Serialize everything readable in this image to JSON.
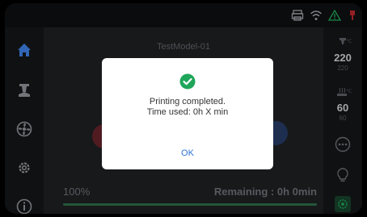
{
  "job": {
    "model_name": "TestModel-01",
    "progress_text": "100%",
    "progress_fraction": 1.0,
    "remaining_text": "Remaining : 0h 0min"
  },
  "temps": {
    "nozzle_current": "220",
    "nozzle_target": "220",
    "bed_current": "60",
    "bed_target": "60"
  },
  "dialog": {
    "message_line1": "Printing completed.",
    "message_line2": "Time used: 0h X min",
    "ok_label": "OK"
  },
  "icons": {
    "status": [
      "printer-icon",
      "wifi-icon",
      "warning-icon",
      "usb-icon"
    ],
    "sidebar": [
      "home-icon",
      "nozzle-icon",
      "fan-icon",
      "settings-icon",
      "info-icon"
    ],
    "right": [
      "nozzle-temp-icon",
      "bed-temp-icon",
      "more-icon",
      "light-bulb-icon",
      "camera-icon"
    ]
  },
  "colors": {
    "accent_blue": "#2a74d4",
    "success_green": "#1fa65a",
    "dialog_bg": "#ffffff",
    "screen_bg": "#1d1f22"
  }
}
